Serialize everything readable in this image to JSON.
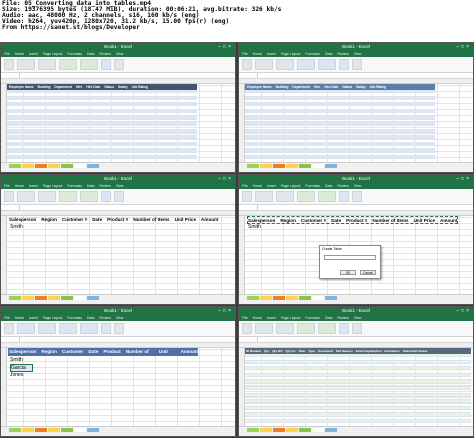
{
  "meta": {
    "line1": "File: 05_Converting_data_into_tables.mp4",
    "line2": "Size: 19376395 bytes (18.47 MiB), duration: 00:06:21, avg.bitrate: 326 kb/s",
    "line3": "Audio: aac, 48000 Hz, 2 channels, s16, 160 kb/s (eng)",
    "line4": "Video: h264, yuv420p, 1280x720, 31.2 kb/s, 15.00 fps(r) (eng)",
    "line5": "From https://sanet.st/blogs/Developer"
  },
  "window": {
    "title": "Book1 - Excel",
    "menu_tabs": [
      "File",
      "Home",
      "Insert",
      "Page Layout",
      "Formulas",
      "Data",
      "Review",
      "View"
    ]
  },
  "panel1": {
    "headers": [
      "Employee Name",
      "Building",
      "Department",
      "Hire",
      "Hire Date",
      "Status",
      "Salary",
      "Job Rating"
    ]
  },
  "panel2": {
    "headers": [
      "Employee Name",
      "Building",
      "Department",
      "Hire",
      "Hire Date",
      "Status",
      "Salary",
      "Job Rating"
    ]
  },
  "panel3": {
    "headers": [
      "Salesperson",
      "Region",
      "Customer #",
      "Date",
      "Product #",
      "Number of Items",
      "Unit Price",
      "Amount"
    ],
    "first_value": "Smith"
  },
  "panel4": {
    "headers": [
      "Salesperson",
      "Region",
      "Customer #",
      "Date",
      "Product #",
      "Number of Items",
      "Unit Price",
      "Amount"
    ],
    "first_value": "Smith",
    "dialog_title": "Create Table",
    "ok": "OK",
    "cancel": "Cancel"
  },
  "panel5": {
    "headers": [
      "Salesperson",
      "Region",
      "Customer #",
      "Date",
      "Product #",
      "Number of Items",
      "Unit Price",
      "Amount"
    ],
    "values": [
      "Smith",
      "Garcia",
      "Jones"
    ]
  },
  "panel6": {
    "headers": [
      "ID Number",
      "Qty",
      "Qty BO",
      "Qty Inv",
      "Date",
      "Type",
      "Generated",
      "Fail Reason",
      "Exam Explanation",
      "Evaluation",
      "Submitted Status"
    ]
  },
  "colors": {
    "excel_green": "#217346",
    "table_header": "#44546a",
    "table_band": "#dde7f4"
  }
}
